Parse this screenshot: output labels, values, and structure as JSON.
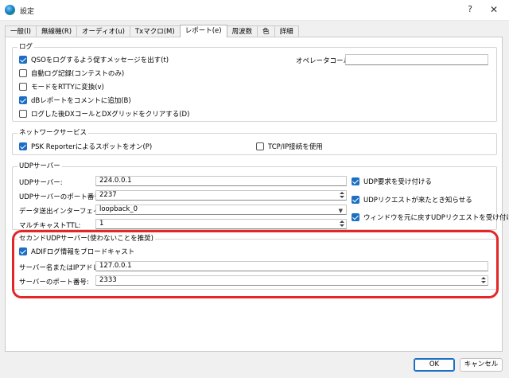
{
  "window": {
    "title": "設定",
    "help": "?",
    "close": "✕"
  },
  "tabs": [
    {
      "label": "一般(l)"
    },
    {
      "label": "無線機(R)"
    },
    {
      "label": "オーディオ(u)"
    },
    {
      "label": "Txマクロ(M)"
    },
    {
      "label": "レポート(e)"
    },
    {
      "label": "周波数"
    },
    {
      "label": "色"
    },
    {
      "label": "詳細"
    }
  ],
  "log": {
    "title": "ログ",
    "items": [
      {
        "label": "QSOをログするよう促すメッセージを出す(t)",
        "checked": true
      },
      {
        "label": "自動ログ記録(コンテストのみ)",
        "checked": false
      },
      {
        "label": "モードをRTTYに変換(v)",
        "checked": false
      },
      {
        "label": "dBレポートをコメントに追加(B)",
        "checked": true
      },
      {
        "label": "ログした後DXコールとDXグリッドをクリアする(D)",
        "checked": false
      }
    ],
    "operator_label": "オペレータコール:",
    "operator_value": ""
  },
  "network": {
    "title": "ネットワークサービス",
    "psk": {
      "label": "PSK Reporterによるスポットをオン(P)",
      "checked": true
    },
    "tcp": {
      "label": "TCP/IP接続を使用",
      "checked": false
    }
  },
  "udp": {
    "title": "UDPサーバー",
    "server_label": "UDPサーバー:",
    "server_value": "224.0.0.1",
    "port_label": "UDPサーバーのポート番号:",
    "port_value": "2237",
    "iface_label": "データ送出インターフェイス:",
    "iface_value": "loopback_0",
    "ttl_label": "マルチキャストTTL:",
    "ttl_value": "1",
    "opts": [
      {
        "label": "UDP要求を受け付ける",
        "checked": true
      },
      {
        "label": "UDPリクエストが来たとき知らせる",
        "checked": true
      },
      {
        "label": "ウィンドウを元に戻すUDPリクエストを受け付ける",
        "checked": true
      }
    ]
  },
  "second": {
    "title": "セカンドUDPサーバー(使わないことを推奨)",
    "adif": {
      "label": "ADIFログ情報をブロードキャスト",
      "checked": true
    },
    "host_label": "サーバー名またはIPアドレス:",
    "host_value": "127.0.0.1",
    "port_label": "サーバーのポート番号:",
    "port_value": "2333"
  },
  "buttons": {
    "ok": "OK",
    "cancel": "キャンセル"
  },
  "colors": {
    "accent": "#1c6fc4",
    "highlight": "#e32626"
  }
}
